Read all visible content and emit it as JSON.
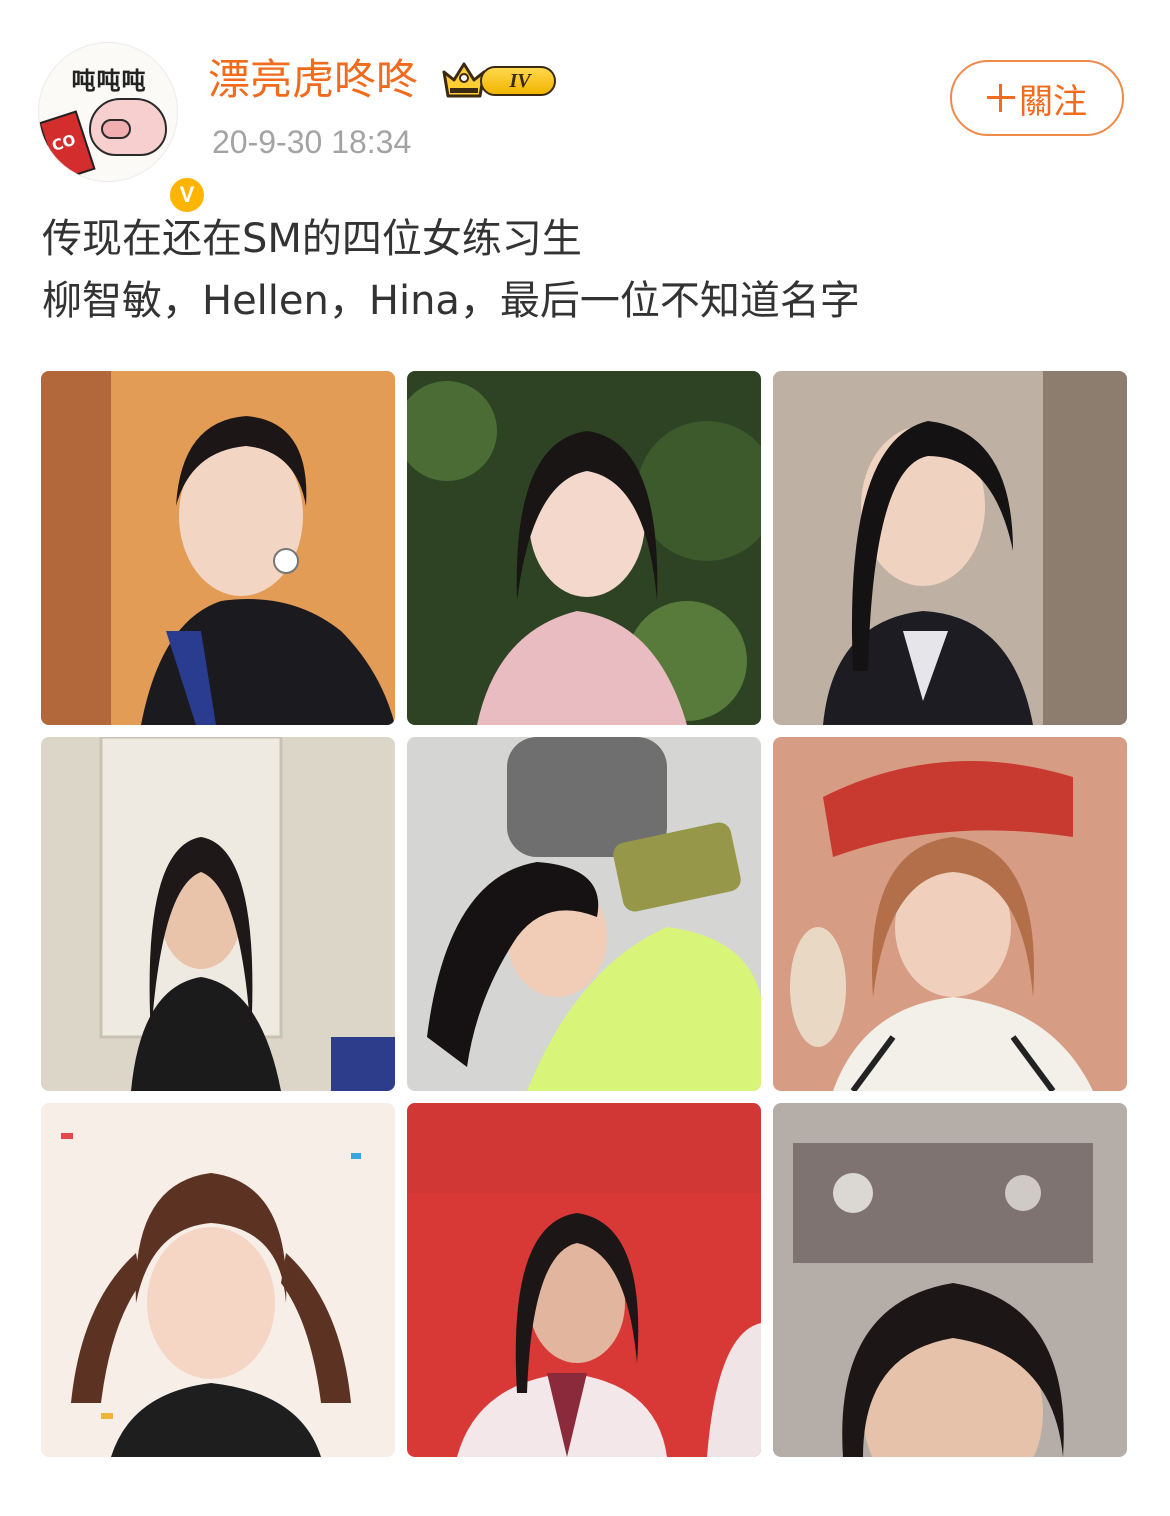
{
  "post": {
    "avatar": {
      "text": "吨吨吨",
      "cup_text": "CO",
      "verified_badge": "V"
    },
    "username": "漂亮虎咚咚",
    "level_badge": "IV",
    "timestamp": "20-9-30 18:34",
    "follow_button": {
      "label": "關注",
      "icon": "plus-icon"
    },
    "text_lines": [
      "传现在还在SM的四位女练习生",
      "柳智敏，Hellen，Hina，最后一位不知道名字"
    ],
    "images": [
      {
        "name": "photo-1",
        "background": "#e19c56"
      },
      {
        "name": "photo-2",
        "background": "#2f4a24"
      },
      {
        "name": "photo-3",
        "background": "#b9a899"
      },
      {
        "name": "photo-4",
        "background": "#d8d3c7"
      },
      {
        "name": "photo-5",
        "background": "#d1d1cf"
      },
      {
        "name": "photo-6",
        "background": "#d59e86"
      },
      {
        "name": "photo-7",
        "background": "#f6ede6"
      },
      {
        "name": "photo-8",
        "background": "#d83a37"
      },
      {
        "name": "photo-9",
        "background": "#b3aca7"
      }
    ]
  },
  "colors": {
    "brand_orange": "#f26a1b",
    "timestamp_gray": "#a3a3a3",
    "body_text": "#333333",
    "vip_gold": "#ffb400"
  }
}
